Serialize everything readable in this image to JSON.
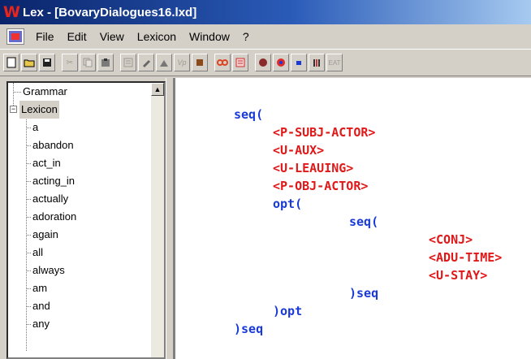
{
  "window": {
    "title": "Lex - [BovaryDialogues16.lxd]",
    "logo": "W"
  },
  "menu": {
    "items": [
      "File",
      "Edit",
      "View",
      "Lexicon",
      "Window",
      "?"
    ]
  },
  "toolbar": {
    "icons": [
      "new-document-icon",
      "open-folder-icon",
      "save-icon",
      "cut-icon",
      "copy-icon",
      "paste-icon",
      "properties-icon",
      "edit-icon",
      "insert-icon",
      "vp-icon",
      "phrase-icon",
      "link-icon",
      "list-icon",
      "stop-icon",
      "record-icon",
      "equals-icon",
      "tree-icon",
      "eat-icon"
    ],
    "vp_label": "Vp",
    "eat_label": "EAT"
  },
  "tree": {
    "roots": [
      {
        "label": "Grammar"
      },
      {
        "label": "Lexicon"
      }
    ],
    "lexicon_children": [
      "a",
      "abandon",
      "act_in",
      "acting_in",
      "actually",
      "adoration",
      "again",
      "all",
      "always",
      "am",
      "and",
      "any"
    ]
  },
  "editor": {
    "lines": [
      {
        "text": "seq(",
        "kind": "kw"
      },
      {
        "text": "<P-SUBJ-ACTOR>",
        "kind": "tag"
      },
      {
        "text": "<U-AUX>",
        "kind": "tag"
      },
      {
        "text": "<U-LEAUING>",
        "kind": "tag"
      },
      {
        "text": "<P-OBJ-ACTOR>",
        "kind": "tag"
      },
      {
        "text": "opt(",
        "kind": "kw"
      },
      {
        "text": "seq(",
        "kind": "kw"
      },
      {
        "text": "<CONJ>",
        "kind": "tag"
      },
      {
        "text": "<ADU-TIME>",
        "kind": "tag"
      },
      {
        "text": "<U-STAY>",
        "kind": "tag"
      },
      {
        "text": ")seq",
        "kind": "kw"
      },
      {
        "text": ")opt",
        "kind": "kw"
      },
      {
        "text": ")seq",
        "kind": "kw"
      }
    ]
  },
  "colors": {
    "keyword": "#1a3ad8",
    "tag": "#e01818",
    "title_bar": "#0a246a"
  }
}
